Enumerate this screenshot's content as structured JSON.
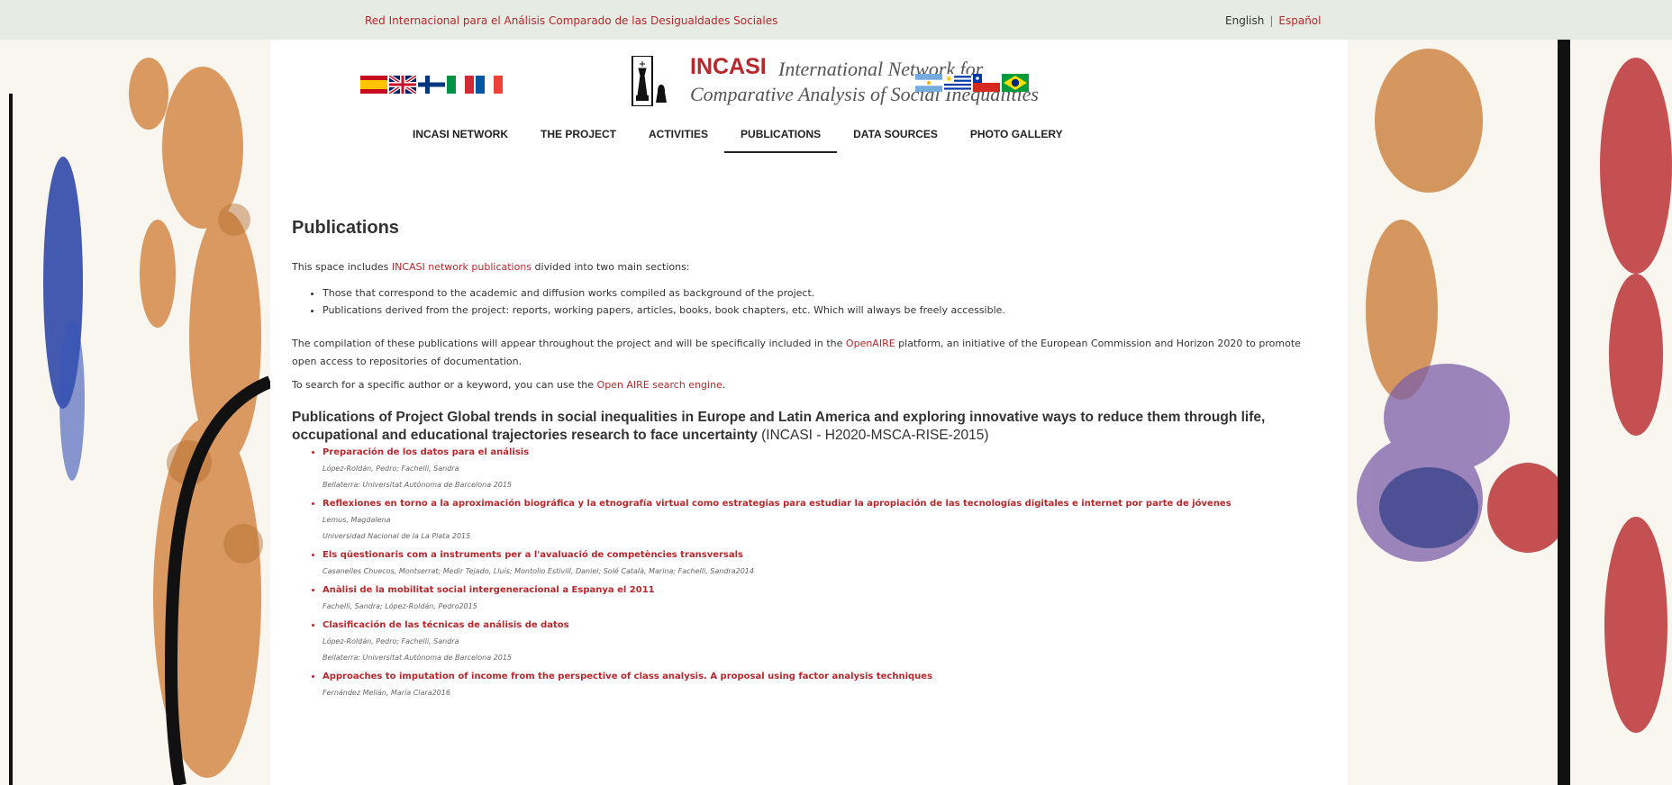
{
  "topbar": {
    "tagline": "Red Internacional para el Análisis Comparado de las Desigualdades Sociales",
    "lang_en": "English",
    "lang_sep": "|",
    "lang_es": "Español"
  },
  "logo": {
    "title": "INCASI",
    "line1": "International Network for",
    "line2": "Comparative Analysis of Social Inequalities"
  },
  "nav": {
    "items": [
      "INCASI NETWORK",
      "THE PROJECT",
      "ACTIVITIES",
      "PUBLICATIONS",
      "DATA SOURCES",
      "PHOTO GALLERY"
    ],
    "active": "PUBLICATIONS"
  },
  "content": {
    "title": "Publications",
    "intro_pre": "This space includes ",
    "intro_link": "INCASI network publications",
    "intro_post": " divided into two main sections:",
    "bullets": [
      "Those that correspond to the academic and diffusion works compiled as background of the project.",
      "Publications derived from the project: reports, working papers, articles, books, book chapters, etc. Which will always be freely accessible."
    ],
    "para1_pre": "The compilation of these publications will appear throughout the project and will be specifically included in the ",
    "para1_link": "OpenAIRE",
    "para1_post": " platform, an initiative of the European Commission and Horizon 2020 to promote open access to repositories of documentation.",
    "para2_pre": "To search for a specific author or a keyword, you can use the ",
    "para2_link": "Open AIRE search engine",
    "para2_post": ".",
    "section_title_bold": "Publications of Project Global trends in social inequalities in Europe and Latin America and exploring innovative ways to reduce them through life, occupational and educational trajectories research to face uncertainty",
    "section_title_tail": " (INCASI - H2020-MSCA-RISE-2015)"
  },
  "publications": [
    {
      "title": "Preparación de los datos para el análisis",
      "authors": "López-Roldán, Pedro; Fachelli, Sandra",
      "source": "Bellaterra: Universitat Autònoma de Barcelona 2015"
    },
    {
      "title": "Reflexiones en torno a la aproximación biográfica y la etnografía virtual como estrategias para estudiar la apropiación de las tecnologías digitales e internet por parte de jóvenes",
      "authors": "Lemus, Magdalena",
      "source": "Universidad Nacional de la La Plata 2015"
    },
    {
      "title": "Els qüestionaris com a instruments per a l'avaluació de competències transversals",
      "authors": "Casanelles Chuecos, Montserrat; Medir Tejado, Lluís; Montolio Estivill, Daniel; Solé Català, Marina; Fachelli, Sandra2014",
      "source": ""
    },
    {
      "title": "Anàlisi de la mobilitat social intergeneracional a Espanya el 2011",
      "authors": "Fachelli, Sandra; López-Roldán, Pedro2015",
      "source": ""
    },
    {
      "title": "Clasificación de las técnicas de análisis de datos",
      "authors": "López-Roldán, Pedro; Fachelli, Sandra",
      "source": "Bellaterra: Universitat Autònoma de Barcelona 2015"
    },
    {
      "title": "Approaches to imputation of income from the perspective of class analysis. A proposal using factor analysis techniques",
      "authors": "Fernández Melián, María Clara2016",
      "source": ""
    }
  ],
  "flags_left": [
    "spain-flag",
    "uk-flag",
    "finland-flag",
    "italy-flag",
    "france-flag"
  ],
  "flags_right": [
    "argentina-flag",
    "uruguay-flag",
    "chile-flag",
    "brazil-flag"
  ],
  "colors": {
    "accent": "#b8272b",
    "topbar": "#e6ece3"
  }
}
